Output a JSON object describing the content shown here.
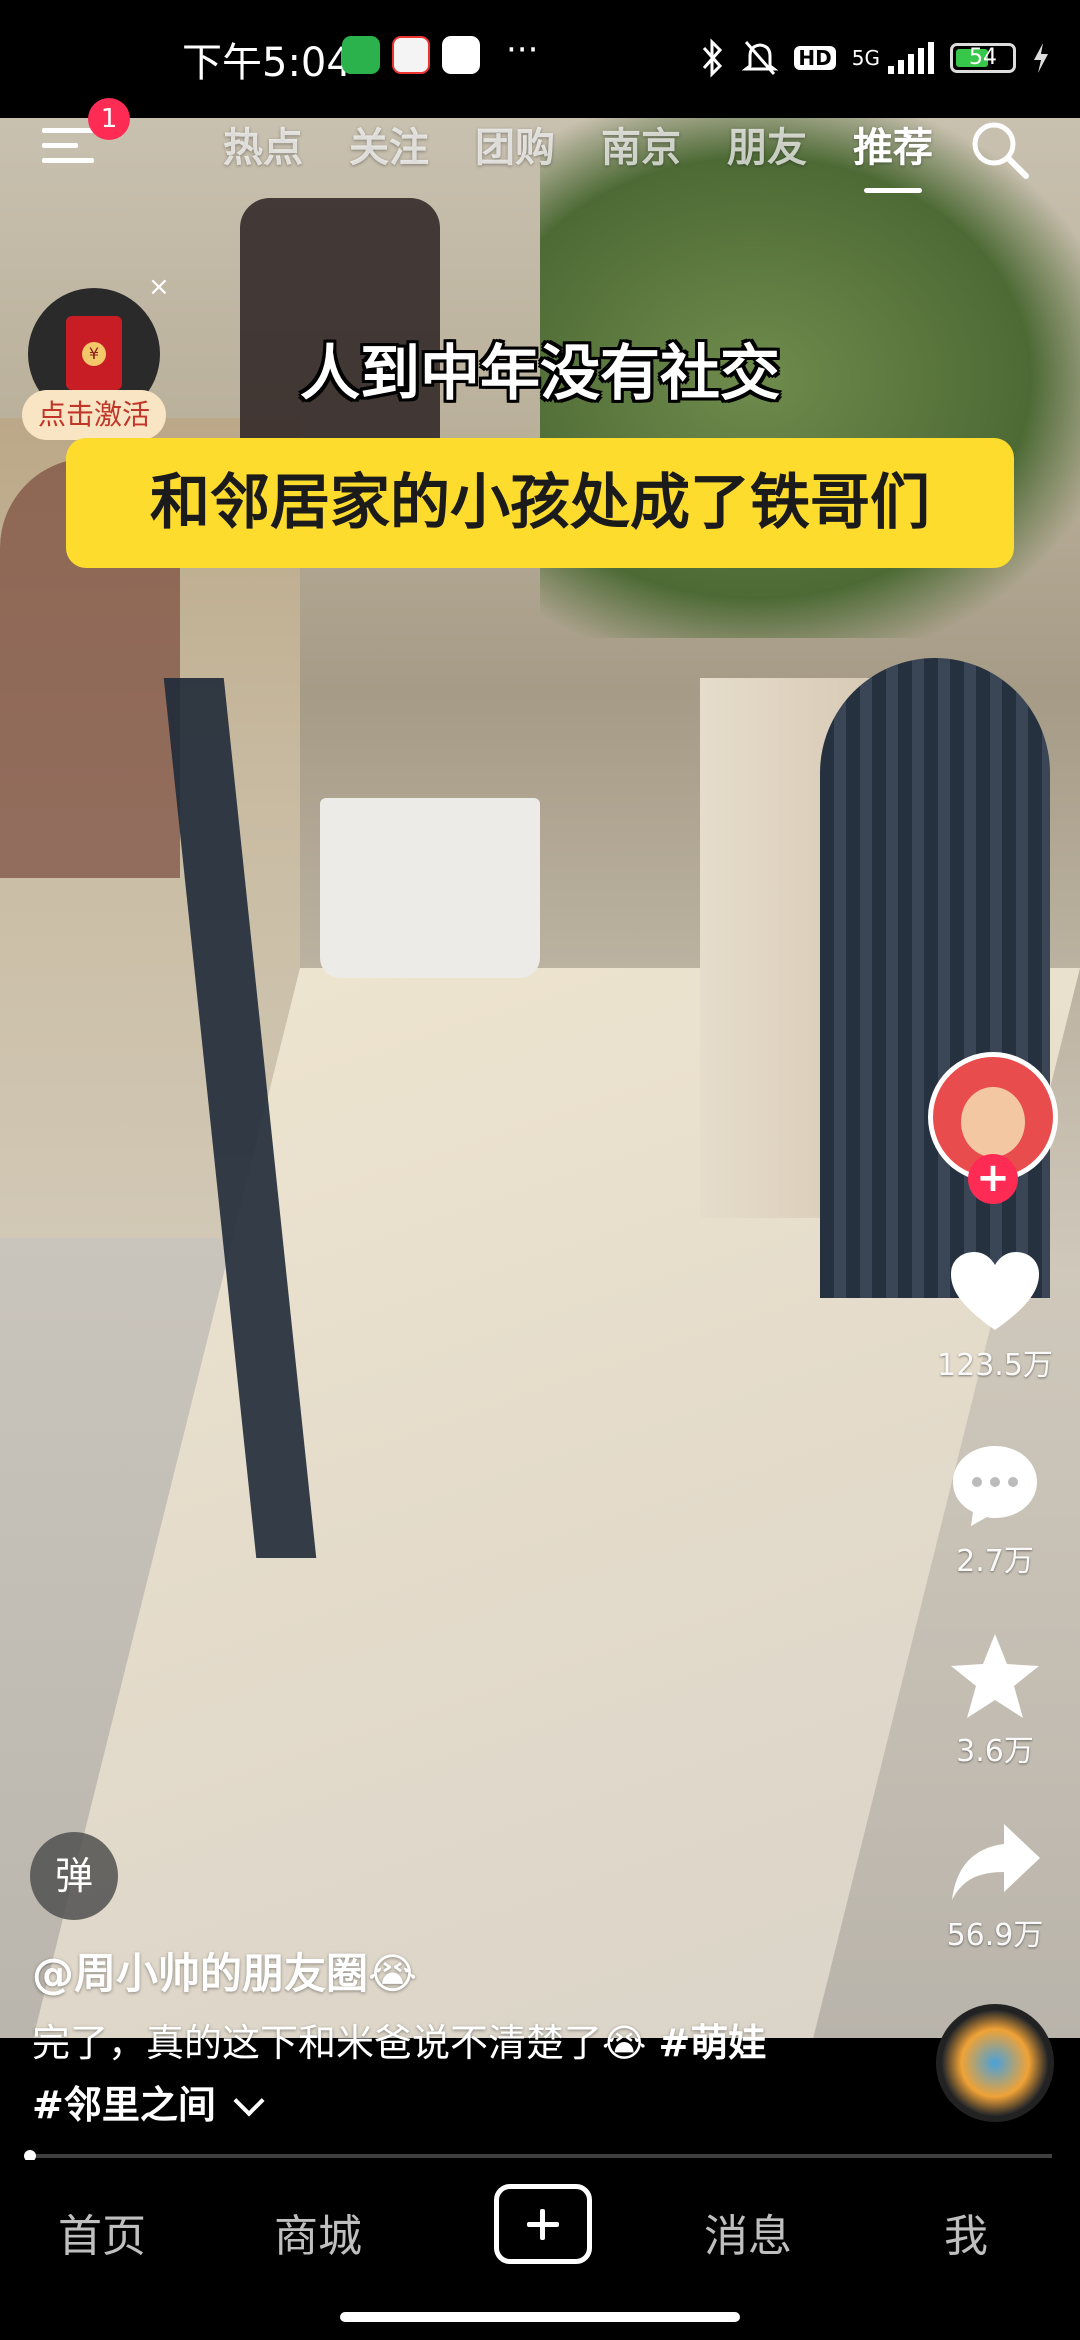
{
  "status_bar": {
    "time": "下午5:04",
    "network": "5G",
    "hd_label": "HD",
    "battery": "54",
    "icons": [
      "wechat-icon",
      "58-app-icon",
      "baidu-netdisk-icon",
      "more-dots-icon",
      "bluetooth-icon",
      "mute-icon",
      "signal-icon",
      "charging-icon"
    ]
  },
  "top_nav": {
    "notification_count": "1",
    "tabs": [
      "热点",
      "关注",
      "团购",
      "南京",
      "朋友",
      "推荐"
    ],
    "active_tab": "推荐"
  },
  "red_packet": {
    "label": "点击激活",
    "close": "×"
  },
  "video": {
    "caption_line1": "人到中年没有社交",
    "caption_line2": "和邻居家的小孩处成了铁哥们"
  },
  "right_rail": {
    "follow": "+",
    "likes": "123.5万",
    "comments": "2.7万",
    "favorites": "3.6万",
    "shares": "56.9万"
  },
  "info": {
    "danmaku_label": "弹",
    "author": "@周小帅的朋友圈😭",
    "description": "完了，真的这下和米爸说不清楚了😭 ",
    "hashtag1": "#萌娃",
    "hashtag2": "#邻里之间",
    "progress": 0.004
  },
  "bottom_tabs": {
    "home": "首页",
    "mall": "商城",
    "messages": "消息",
    "me": "我"
  },
  "colors": {
    "accent_red": "#fe2c55",
    "caption_yellow": "#fddc2e",
    "battery_green": "#37c74b"
  }
}
